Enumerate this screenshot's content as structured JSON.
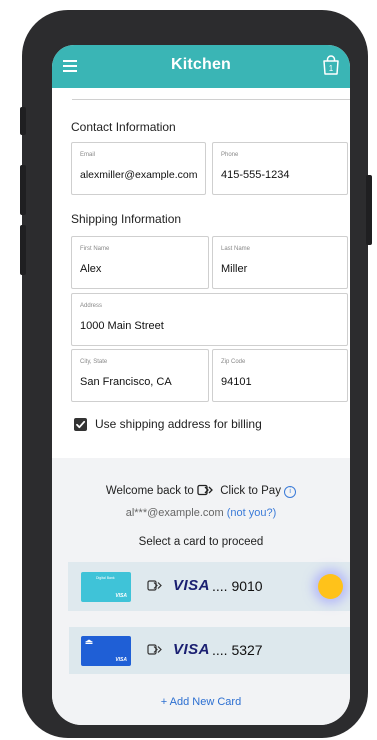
{
  "app": {
    "title": "Kitchen",
    "cart_count": "1"
  },
  "contact": {
    "section_title": "Contact Information",
    "email_label": "Email",
    "email_value": "alexmiller@example.com",
    "phone_label": "Phone",
    "phone_value": "415-555-1234"
  },
  "shipping": {
    "section_title": "Shipping Information",
    "first_name_label": "First Name",
    "first_name_value": "Alex",
    "last_name_label": "Last Name",
    "last_name_value": "Miller",
    "address_label": "Address",
    "address_value": "1000 Main Street",
    "city_label": "City, State",
    "city_value": "San Francisco, CA",
    "zip_label": "Zip Code",
    "zip_value": "94101",
    "billing_checkbox_label": "Use shipping address for billing",
    "billing_checked": true
  },
  "click_to_pay": {
    "welcome_prefix": "Welcome back to",
    "brand_label": "Click to Pay",
    "masked_email": "al***@example.com",
    "not_you_link": "(not you?)",
    "select_prompt": "Select a card to proceed",
    "cards": [
      {
        "network": "VISA",
        "masked_number": ".... 9010",
        "thumb_bank_label": "Digital Bank",
        "thumb_color": "#3fc3d8",
        "selected": true
      },
      {
        "network": "VISA",
        "masked_number": ".... 5327",
        "thumb_bank_label": "",
        "thumb_color": "#1f5fd6",
        "selected": false
      }
    ],
    "add_card_label": "+ Add New Card"
  },
  "colors": {
    "accent": "#3ab5b5",
    "link": "#2c6fd1",
    "visa_blue": "#1a1f71",
    "selector_yellow": "#ffc21a"
  }
}
